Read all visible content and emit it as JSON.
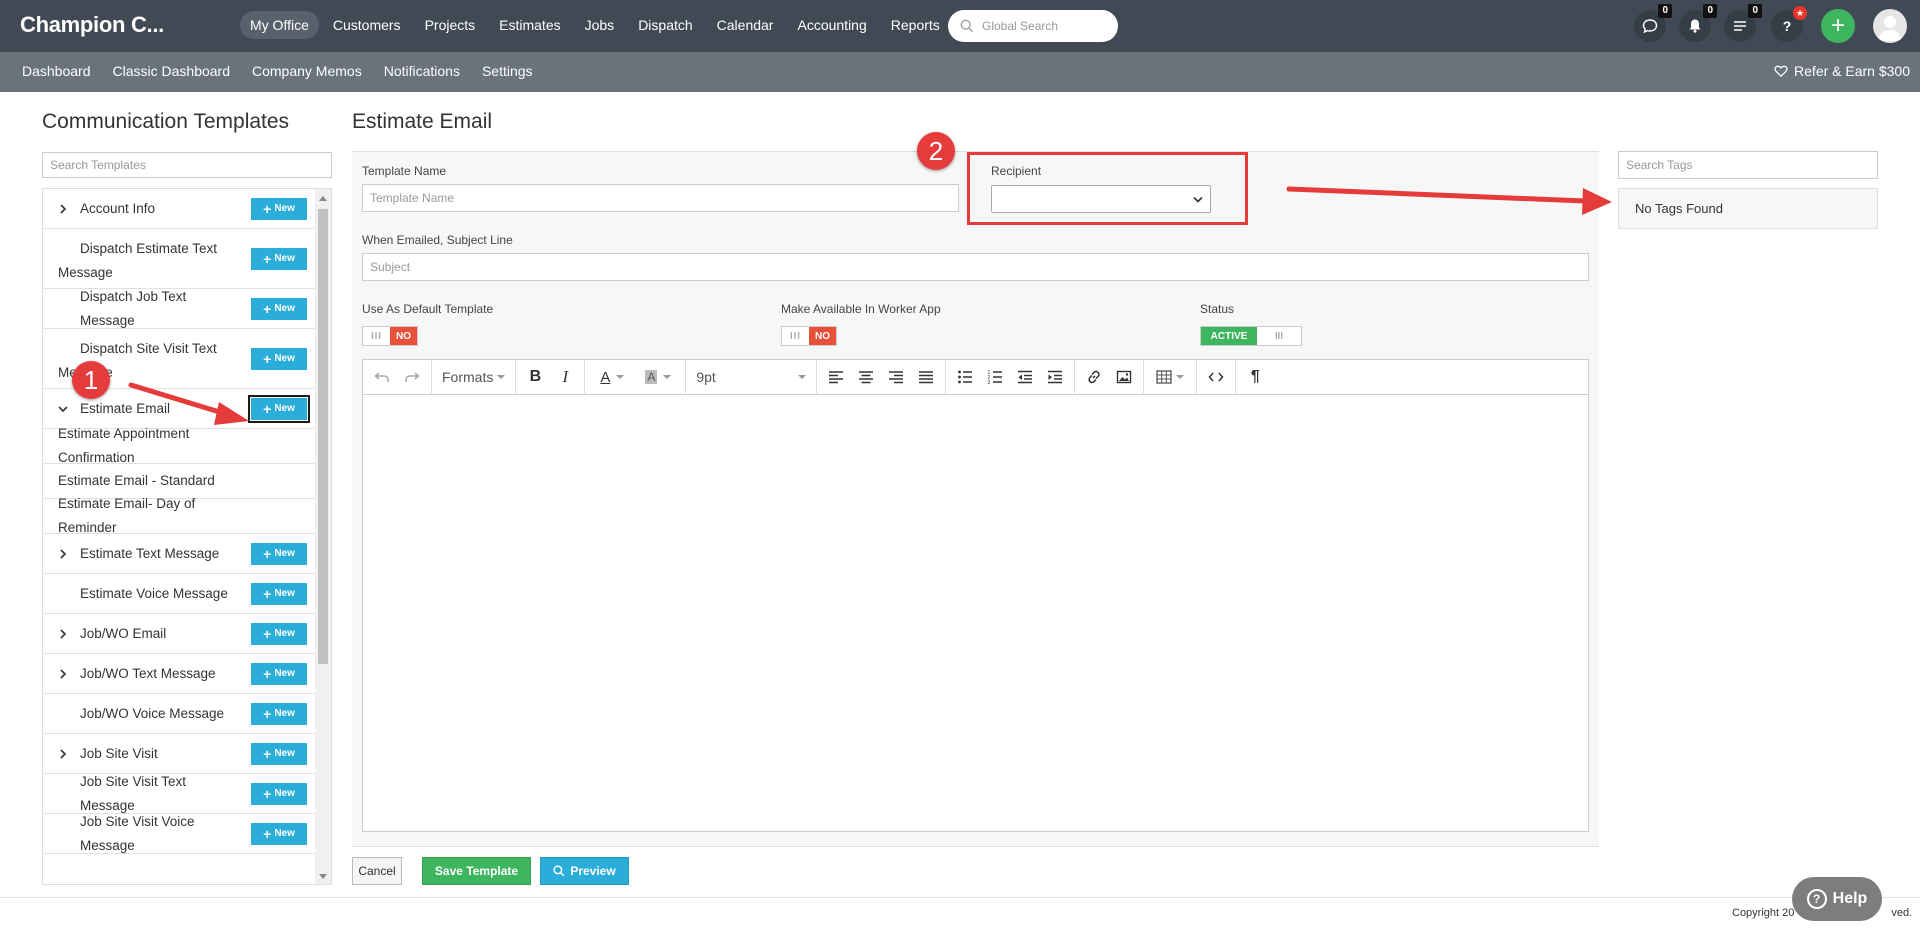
{
  "brand": "Champion C...",
  "main_nav": [
    "My Office",
    "Customers",
    "Projects",
    "Estimates",
    "Jobs",
    "Dispatch",
    "Calendar",
    "Accounting",
    "Reports"
  ],
  "global_search_placeholder": "Global Search",
  "badges": {
    "chat": "0",
    "notifications": "0",
    "tasks": "0"
  },
  "sub_nav": [
    "Dashboard",
    "Classic Dashboard",
    "Company Memos",
    "Notifications",
    "Settings"
  ],
  "refer": "Refer & Earn $300",
  "left": {
    "title": "Communication Templates",
    "search_placeholder": "Search Templates",
    "new_label": "New",
    "templates": [
      {
        "label": "Account Info",
        "expandable": true,
        "has_new": true
      },
      {
        "label": "Dispatch Estimate Text Message",
        "expandable": false,
        "has_new": true
      },
      {
        "label": "Dispatch Job Text Message",
        "expandable": false,
        "has_new": true
      },
      {
        "label": "Dispatch Site Visit Text Message",
        "expandable": false,
        "has_new": true
      },
      {
        "label": "Estimate Email",
        "expandable": true,
        "expanded": true,
        "has_new": true
      },
      {
        "label": "Estimate Appointment Confirmation",
        "child": true
      },
      {
        "label": "Estimate Email - Standard",
        "child": true
      },
      {
        "label": "Estimate Email- Day of Reminder",
        "child": true
      },
      {
        "label": "Estimate Text Message",
        "expandable": true,
        "has_new": true
      },
      {
        "label": "Estimate Voice Message",
        "expandable": false,
        "has_new": true
      },
      {
        "label": "Job/WO Email",
        "expandable": true,
        "has_new": true
      },
      {
        "label": "Job/WO Text Message",
        "expandable": true,
        "has_new": true
      },
      {
        "label": "Job/WO Voice Message",
        "expandable": false,
        "has_new": true
      },
      {
        "label": "Job Site Visit",
        "expandable": true,
        "has_new": true
      },
      {
        "label": "Job Site Visit Text Message",
        "expandable": false,
        "has_new": true
      },
      {
        "label": "Job Site Visit Voice Message",
        "expandable": false,
        "has_new": true
      }
    ]
  },
  "form": {
    "title": "Estimate Email",
    "template_name_label": "Template Name",
    "template_name_placeholder": "Template Name",
    "recipient_label": "Recipient",
    "subject_label": "When Emailed, Subject Line",
    "subject_placeholder": "Subject",
    "default_label": "Use As Default Template",
    "worker_app_label": "Make Available In Worker App",
    "status_label": "Status",
    "toggle_no": "NO",
    "toggle_active": "ACTIVE",
    "formats_label": "Formats",
    "font_size": "9pt",
    "cancel": "Cancel",
    "save": "Save Template",
    "preview": "Preview"
  },
  "tags": {
    "search_placeholder": "Search Tags",
    "empty": "No Tags Found"
  },
  "annotations": {
    "one": "1",
    "two": "2"
  },
  "footer": {
    "copyright": "Copyright 20",
    "suffix": "ved.",
    "help": "Help"
  },
  "colors": {
    "topbar": "#414a54",
    "subbar": "#6a727b",
    "new_button": "#2aaed9",
    "save_button": "#3eb55f",
    "annotation": "#e63b3b"
  }
}
